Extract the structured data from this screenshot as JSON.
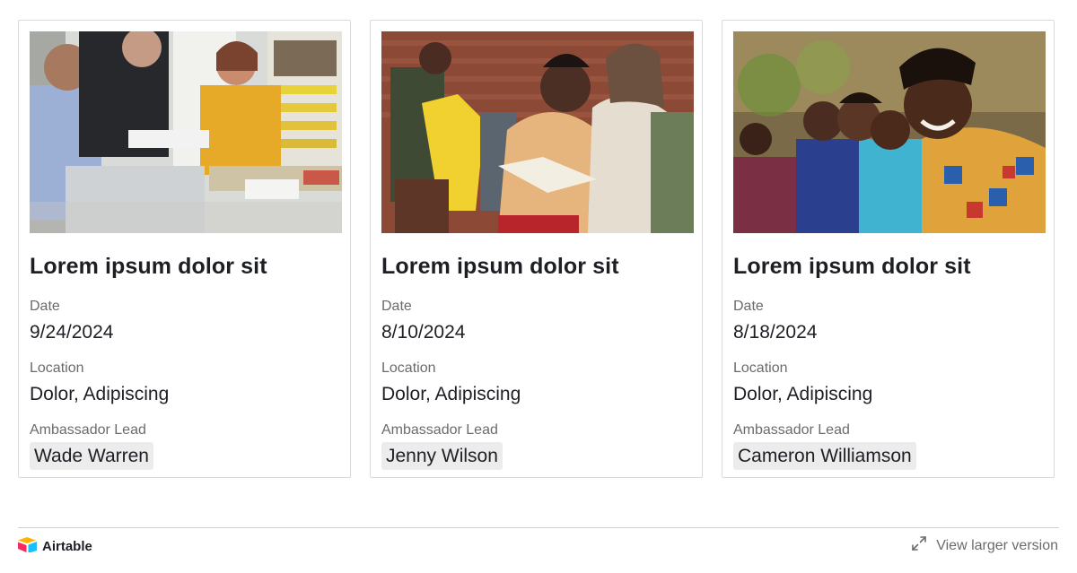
{
  "cards": [
    {
      "image": "classroom-meeting-photo",
      "title": "Lorem ipsum dolor sit",
      "date_label": "Date",
      "date": "9/24/2024",
      "location_label": "Location",
      "location": "Dolor, Adipiscing",
      "lead_label": "Ambassador Lead",
      "lead": "Wade Warren"
    },
    {
      "image": "thrift-shop-book-photo",
      "title": "Lorem ipsum dolor sit",
      "date_label": "Date",
      "date": "8/10/2024",
      "location_label": "Location",
      "location": "Dolor, Adipiscing",
      "lead_label": "Ambassador Lead",
      "lead": "Jenny Wilson"
    },
    {
      "image": "smiling-group-photo",
      "title": "Lorem ipsum dolor sit",
      "date_label": "Date",
      "date": "8/18/2024",
      "location_label": "Location",
      "location": "Dolor, Adipiscing",
      "lead_label": "Ambassador Lead",
      "lead": "Cameron Williamson"
    }
  ],
  "footer": {
    "brand": "Airtable",
    "brand_icon": "airtable-logo-icon",
    "view_larger": "View larger version",
    "view_larger_icon": "expand-icon"
  },
  "colors": {
    "logo_yellow": "#fcb400",
    "logo_blue": "#18bfff",
    "logo_red": "#f82b60"
  }
}
